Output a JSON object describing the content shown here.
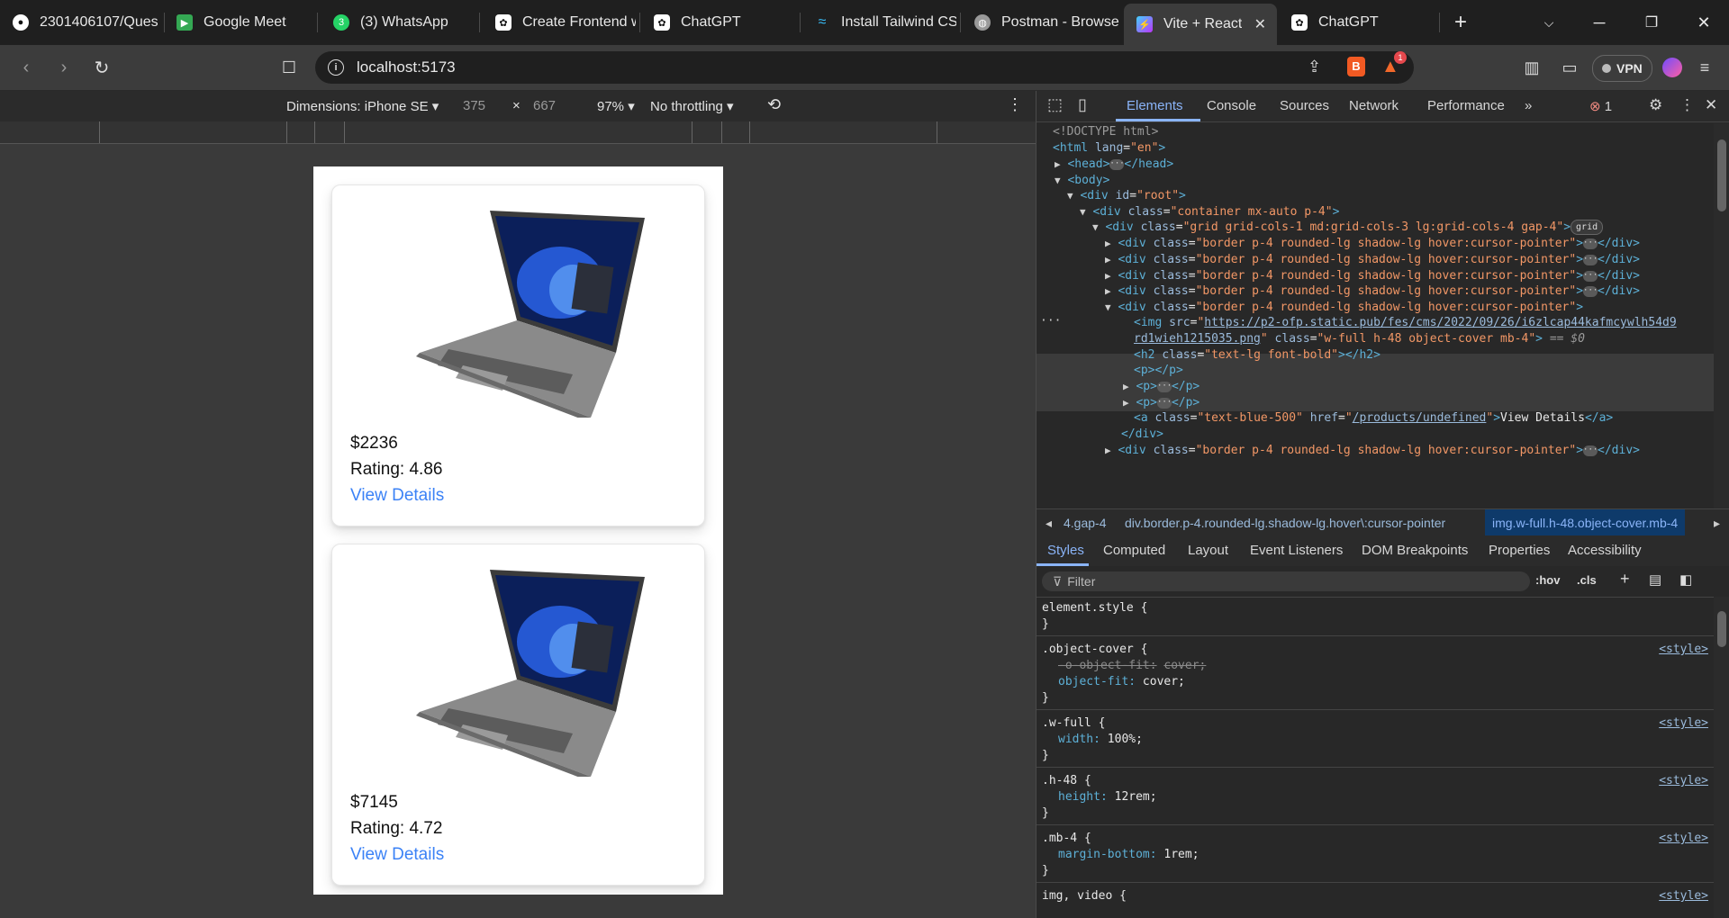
{
  "tabs": [
    {
      "title": "2301406107/Ques",
      "icon": "github-icon"
    },
    {
      "title": "Google Meet",
      "icon": "google-meet-icon"
    },
    {
      "title": "(3) WhatsApp",
      "icon": "whatsapp-icon"
    },
    {
      "title": "Create Frontend w",
      "icon": "chatgpt-icon"
    },
    {
      "title": "ChatGPT",
      "icon": "chatgpt-icon"
    },
    {
      "title": "Install Tailwind CS",
      "icon": "tailwind-icon"
    },
    {
      "title": "Postman - Browse",
      "icon": "postman-icon"
    },
    {
      "title": "Vite + React",
      "icon": "vite-icon",
      "active": true
    },
    {
      "title": "ChatGPT",
      "icon": "chatgpt-icon"
    }
  ],
  "address": {
    "url": "localhost:5173",
    "brave_badge": "1"
  },
  "vpn_label": "VPN",
  "device_toolbar": {
    "dimensions": "Dimensions: iPhone SE",
    "width": "375",
    "x": "×",
    "height": "667",
    "zoom": "97%",
    "throttle": "No throttling"
  },
  "products": [
    {
      "price": "$2236",
      "rating": "Rating: 4.86",
      "link": "View Details"
    },
    {
      "price": "$7145",
      "rating": "Rating: 4.72",
      "link": "View Details"
    }
  ],
  "devtools": {
    "tabs": [
      "Elements",
      "Console",
      "Sources",
      "Network",
      "Performance"
    ],
    "error_count": "1",
    "dom": {
      "doctype": "<!DOCTYPE html>",
      "html_open": "<html",
      "lang_attr": "lang",
      "lang_val": "\"en\"",
      "head": "<head>",
      "head_close": "</head>",
      "body": "<body>",
      "root_tag": "<div",
      "root_attr": "id",
      "root_val": "\"root\"",
      "container_val": "\"container mx-auto p-4\"",
      "grid_val": "\"grid grid-cols-1 md:grid-cols-3 lg:grid-cols-4 gap-4\"",
      "grid_badge": "grid",
      "card_val": "\"border p-4 rounded-lg shadow-lg hover:cursor-pointer\"",
      "div_close": "</div>",
      "img_src_url": "https://p2-ofp.static.pub/fes/cms/2022/09/26/i6zlcap44kafmcywlh54d9",
      "img_src_url2": "rd1wieh1215035.png",
      "img_class_val": "\"w-full h-48 object-cover mb-4\"",
      "img_eq": "== $0",
      "h2_class_val": "\"text-lg font-bold\"",
      "p_empty": "<p></p>",
      "a_class_val": "\"text-blue-500\"",
      "a_href": "/products/undefined",
      "a_text": "View Details"
    },
    "crumbs": [
      "4.gap-4",
      "div.border.p-4.rounded-lg.shadow-lg.hover\\:cursor-pointer",
      "img.w-full.h-48.object-cover.mb-4"
    ],
    "style_tabs": [
      "Styles",
      "Computed",
      "Layout",
      "Event Listeners",
      "DOM Breakpoints",
      "Properties",
      "Accessibility"
    ],
    "filter_placeholder": "Filter",
    "hov": ":hov",
    "cls": ".cls",
    "rules": {
      "element_style": "element.style {",
      "object_cover": ".object-cover {",
      "o_object_fit": "-o-object-fit:",
      "o_object_fit_val": "cover;",
      "object_fit": "object-fit:",
      "object_fit_val": "cover;",
      "w_full": ".w-full {",
      "width": "width:",
      "width_val": "100%;",
      "h_48": ".h-48 {",
      "height": "height:",
      "height_val": "12rem;",
      "mb_4": ".mb-4 {",
      "margin_bottom": "margin-bottom:",
      "margin_bottom_val": "1rem;",
      "img_video": "img, video {",
      "close": "}",
      "source": "<style>"
    }
  }
}
